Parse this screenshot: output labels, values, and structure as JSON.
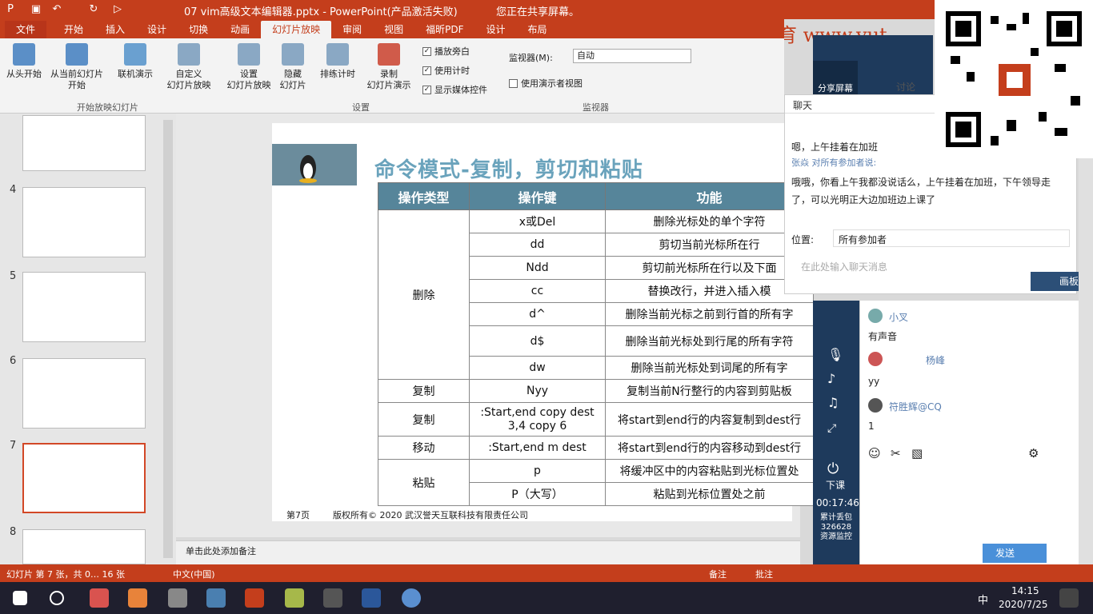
{
  "titlebar": {
    "title": "07 vim高级文本编辑器.pptx  -  PowerPoint(产品激活失败)",
    "share_banner": "您正在共享屏幕。"
  },
  "tabs": [
    "文件",
    "开始",
    "插入",
    "设计",
    "切换",
    "动画",
    "幻灯片放映",
    "审阅",
    "视图",
    "福昕PDF",
    "设计",
    "布局"
  ],
  "ribbon": {
    "buttons": [
      {
        "label": "从头开始"
      },
      {
        "label": "从当前幻灯片\n开始"
      },
      {
        "label": "联机演示"
      },
      {
        "label": "自定义\n幻灯片放映"
      },
      {
        "label": "设置\n幻灯片放映"
      },
      {
        "label": "隐藏\n幻灯片"
      },
      {
        "label": "排练计时"
      },
      {
        "label": "录制\n幻灯片演示"
      }
    ],
    "checks": [
      "播放旁白",
      "使用计时",
      "显示媒体控件"
    ],
    "monitor_label": "监视器(M):",
    "monitor_value": "自动",
    "presenter_view": "使用演示者视图",
    "group_start": "开始放映幻灯片",
    "group_setup": "设置",
    "group_monitor": "监视器"
  },
  "thumbnails": {
    "numbers": [
      "4",
      "5",
      "6",
      "7",
      "8"
    ]
  },
  "slide": {
    "title": "命令模式-复制，剪切和粘贴",
    "headers": [
      "操作类型",
      "操作键",
      "功能"
    ],
    "groups": {
      "delete": "删除",
      "copy": "复制",
      "copy2": "复制",
      "move": "移动",
      "paste": "粘贴"
    },
    "keys": [
      "x或Del",
      "dd",
      "Ndd",
      "cc",
      "d^",
      "d$",
      "dw",
      "Nyy",
      ":Start,end copy dest\n3,4 copy 6",
      ":Start,end m dest",
      "p",
      "P（大写）"
    ],
    "funcs": [
      "删除光标处的单个字符",
      "剪切当前光标所在行",
      "剪切前光标所在行以及下面",
      "替换改行，并进入插入模",
      "删除当前光标之前到行首的所有字",
      "删除当前光标处到行尾的所有字符",
      "删除当前光标处到词尾的所有字",
      "复制当前N行整行的内容到剪贴板",
      "将start到end行的内容复制到dest行",
      "将start到end行的内容移动到dest行",
      "将缓冲区中的内容粘贴到光标位置处",
      "粘贴到光标位置处之前"
    ],
    "footer_page": "第7页",
    "footer_copyright": "版权所有© 2020 武汉誉天互联科技有限责任公司"
  },
  "notes": "单击此处添加备注",
  "statusbar": {
    "slide_info": "幻灯片 第 7 张，共 0… 16 张",
    "language": "中文(中国)",
    "notes_btn": "备注",
    "comments_btn": "批注"
  },
  "chat": {
    "title": "聊天",
    "msg1": "嗯，上午挂着在加班",
    "sender2": "张焱 对所有参加者说:",
    "msg2": "哦哦，你看上午我都没说话么，上午挂着在加班，下午领导走了，可以光明正大边加班边上课了",
    "to_label": "位置:",
    "to_value": "所有参加者",
    "input_placeholder": "在此处输入聊天消息",
    "whiteboard": "画板",
    "share": "分享屏幕",
    "discuss": "讨论",
    "users": [
      {
        "name": "小叉",
        "msg": "有声音"
      },
      {
        "name": "杨峰",
        "msg": "yy"
      },
      {
        "name": "符胜辉@CQ",
        "msg": "1"
      }
    ],
    "send": "发送",
    "end_class": "下课",
    "timer": "00:17:46",
    "stats": "累计丢包\n326628\n资源监控"
  },
  "watermark": "誉天教育  www.yut",
  "taskbar": {
    "time": "14:15",
    "date": "2020/7/25",
    "ime": "中"
  }
}
